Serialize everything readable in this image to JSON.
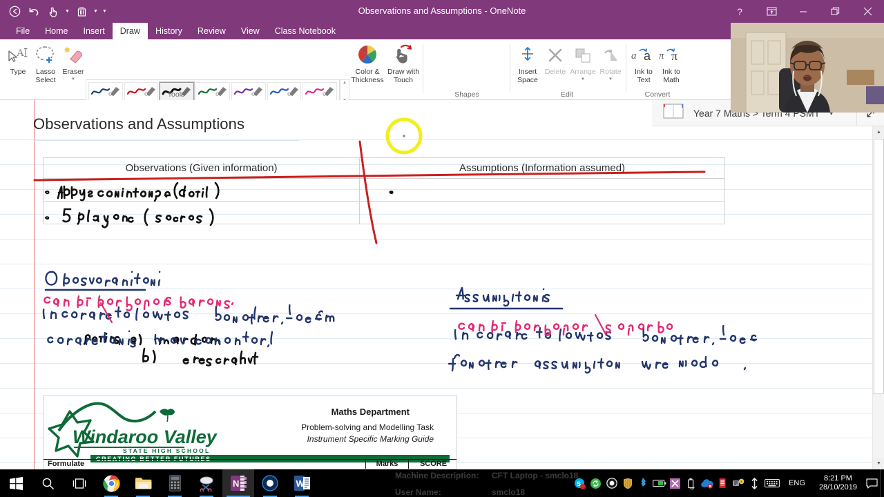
{
  "window": {
    "title": "Observations and Assumptions - OneNote",
    "quick_access": [
      {
        "name": "back-button",
        "icon": "back-arrow-icon"
      },
      {
        "name": "undo-button",
        "icon": "undo-arrow-icon"
      },
      {
        "name": "touch-mode-button",
        "icon": "touch-pen-icon"
      },
      {
        "name": "full-page-view-button",
        "icon": "full-page-icon"
      },
      {
        "name": "customize-qat-button",
        "icon": "chevron-down-icon"
      }
    ],
    "controls": [
      {
        "name": "help-button",
        "label": "?"
      },
      {
        "name": "ribbon-display-options-button",
        "label": "ribbon-options-icon"
      },
      {
        "name": "minimize-button",
        "label": "—"
      },
      {
        "name": "restore-button",
        "label": "restore-icon"
      },
      {
        "name": "close-button",
        "label": "✕"
      }
    ]
  },
  "menu": {
    "items": [
      {
        "label": "File",
        "active": false
      },
      {
        "label": "Home",
        "active": false
      },
      {
        "label": "Insert",
        "active": false
      },
      {
        "label": "Draw",
        "active": true
      },
      {
        "label": "History",
        "active": false
      },
      {
        "label": "Review",
        "active": false
      },
      {
        "label": "View",
        "active": false
      },
      {
        "label": "Class Notebook",
        "active": false
      }
    ]
  },
  "ribbon": {
    "groups": [
      {
        "name": "tools",
        "label": "Tools"
      },
      {
        "name": "shapes",
        "label": "Shapes"
      },
      {
        "name": "edit",
        "label": "Edit"
      },
      {
        "name": "convert",
        "label": "Convert"
      }
    ],
    "tools": {
      "type_label": "Type",
      "lasso_label": "Lasso Select",
      "eraser_label": "Eraser",
      "pens_row1": [
        "#1f3a7a",
        "#cc1111",
        "#111111",
        "#116b33",
        "#6b2fa0",
        "#2255cc",
        "#e0268f"
      ],
      "pens_row2": [
        "#ffffff",
        "#b7e6bd",
        "#f6c6d6",
        "#f7efa8",
        "#bfe4f6",
        "#fff200",
        "#0d7a3c"
      ],
      "selected_pen_index": 2
    },
    "color_thickness_label": "Color & Thickness",
    "draw_with_touch_label": "Draw with Touch",
    "insert_space_label": "Insert Space",
    "delete_label": "Delete",
    "arrange_label": "Arrange",
    "rotate_label": "Rotate",
    "ink_to_text_label": "Ink to Text",
    "ink_to_math_label": "Ink to Math"
  },
  "notebook_bar": {
    "breadcrumb": "Year 7 Maths > Term 4 PSMT",
    "caret": "▼"
  },
  "page": {
    "title": "Observations and Assumptions",
    "table": {
      "headers": [
        "Observations (Given information)",
        "Assumptions (Information assumed)"
      ],
      "rows": [
        [
          "",
          ""
        ],
        [
          "",
          ""
        ]
      ]
    },
    "ink_notes": {
      "left_bullets": [
        "Abbys conditions (detail)",
        "5 players (scores)",
        "options a) random",
        "b) research"
      ],
      "left_heading": "Observations",
      "left_pink": "Can be dot point/paragraph.",
      "left_body": "In order to solve this problem, the following observations were considered.",
      "right_heading": "Assumptions",
      "right_pink": "Can be dot point/paragraph",
      "right_body": "In order to solve this problem, the following assumption were made."
    },
    "document": {
      "school_name": "Windaroo Valley",
      "school_sub": "STATE HIGH SCHOOL",
      "school_tagline": "CREATING BETTER FUTURES",
      "department": "Maths Department",
      "task_line": "Problem-solving and Modelling Task",
      "guide_line": "Instrument Specific Marking Guide",
      "table_headers": [
        "Formulate",
        "Marks",
        "SCORE"
      ]
    }
  },
  "taskbar": {
    "icons": [
      {
        "name": "start-button",
        "icon": "windows-logo-icon"
      },
      {
        "name": "search-button",
        "icon": "search-icon"
      },
      {
        "name": "task-view-button",
        "icon": "task-view-icon"
      },
      {
        "name": "chrome-button",
        "icon": "chrome-icon"
      },
      {
        "name": "file-explorer-button",
        "icon": "folder-icon"
      },
      {
        "name": "calculator-button",
        "icon": "calculator-icon"
      },
      {
        "name": "snipping-tool-button",
        "icon": "scissors-icon"
      },
      {
        "name": "onenote-button",
        "icon": "onenote-icon"
      },
      {
        "name": "recorder-button",
        "icon": "record-circle-icon"
      },
      {
        "name": "word-button",
        "icon": "word-icon"
      }
    ],
    "tray_icons": [
      {
        "name": "skype-tray-icon",
        "icon": "skype-icon"
      },
      {
        "name": "sync-tray-icon",
        "icon": "sync-icon"
      },
      {
        "name": "recorder-tray-icon",
        "icon": "record-icon"
      },
      {
        "name": "shield-tray-icon",
        "icon": "shield-icon"
      },
      {
        "name": "bluetooth-tray-icon",
        "icon": "bluetooth-icon"
      },
      {
        "name": "battery-tray-icon",
        "icon": "battery-icon"
      },
      {
        "name": "snip-tray-icon",
        "icon": "snip-icon"
      },
      {
        "name": "usb-tray-icon",
        "icon": "usb-icon"
      },
      {
        "name": "onedrive-tray-icon",
        "icon": "cloud-error-icon"
      },
      {
        "name": "storage-tray-icon",
        "icon": "storage-icon"
      },
      {
        "name": "network-tray-icon",
        "icon": "network-icon"
      },
      {
        "name": "volume-tray-icon",
        "icon": "volume-icon"
      }
    ],
    "language": "ENG",
    "time": "8:21 PM",
    "date": "28/10/2019",
    "overlay": {
      "machine_label": "Machine Description:",
      "machine_value": "CFT Laptop - smclo18",
      "user_label": "User Name:",
      "user_value": "smclo18"
    }
  },
  "colors": {
    "brand_purple": "#80397b",
    "ink_red": "#cc1f1f",
    "ink_blue": "#23356b",
    "ink_pink": "#e52a72",
    "ink_black": "#111111",
    "highlight_yellow": "#f0ef1e",
    "school_green": "#0d6b38"
  }
}
